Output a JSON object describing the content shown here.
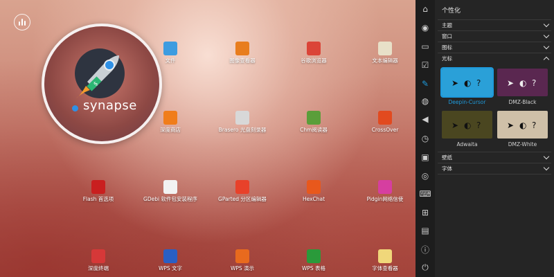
{
  "desktop": {
    "synapse_label": "synapse",
    "apps": [
      {
        "label": "文件",
        "icon": "folder-icon",
        "color": "#3d9ce0"
      },
      {
        "label": "图像查看器",
        "icon": "image-viewer-icon",
        "color": "#e87d1e"
      },
      {
        "label": "谷歌浏览器",
        "icon": "chrome-icon",
        "color": "#db4437"
      },
      {
        "label": "文本编辑器",
        "icon": "text-editor-icon",
        "color": "#e8e0c8"
      },
      {
        "label": "深度商店",
        "icon": "store-icon",
        "color": "#f07d1b"
      },
      {
        "label": "Brasero 光盘刻录器",
        "icon": "disc-burner-icon",
        "color": "#d8d8d8"
      },
      {
        "label": "Chm阅读器",
        "icon": "chm-reader-icon",
        "color": "#5a9e3a"
      },
      {
        "label": "CrossOver",
        "icon": "crossover-icon",
        "color": "#e24a1f"
      },
      {
        "label": "Flash 首选项",
        "icon": "flash-icon",
        "color": "#c91f1f"
      },
      {
        "label": "GDebi 软件包安装程序",
        "icon": "debian-package-icon",
        "color": "#f2f2f2"
      },
      {
        "label": "GParted 分区编辑器",
        "icon": "partition-editor-icon",
        "color": "#e8412a"
      },
      {
        "label": "HexChat",
        "icon": "hexchat-icon",
        "color": "#e8581c"
      },
      {
        "label": "Pidgin网络信使",
        "icon": "pidgin-icon",
        "color": "#d63ea0"
      },
      {
        "label": "深度终端",
        "icon": "terminal-icon",
        "color": "#d63838"
      },
      {
        "label": "WPS 文字",
        "icon": "wps-writer-icon",
        "color": "#2a5fc4"
      },
      {
        "label": "WPS 演示",
        "icon": "wps-presentation-icon",
        "color": "#e86a1e"
      },
      {
        "label": "WPS 表格",
        "icon": "wps-spreadsheet-icon",
        "color": "#2a9a3a"
      },
      {
        "label": "字体查看器",
        "icon": "font-viewer-icon",
        "color": "#f0d77a"
      }
    ]
  },
  "panel": {
    "title": "个性化",
    "sections": {
      "theme": "主题",
      "window": "窗口",
      "icons": "图标",
      "cursor": "光标",
      "wallpaper": "壁纸",
      "font": "字体"
    },
    "cursors": [
      {
        "name": "Deepin-Cursor",
        "bg": "#2aa0d8",
        "selected": true
      },
      {
        "name": "DMZ-Black",
        "bg": "#5a2750",
        "selected": false
      },
      {
        "name": "Adwaita",
        "bg": "#4a4620",
        "selected": false
      },
      {
        "name": "DMZ-White",
        "bg": "#cfc0a8",
        "selected": false
      }
    ],
    "accent": "#1e9bdd"
  },
  "sidebar": {
    "icons": [
      "home-icon",
      "account-icon",
      "display-icon",
      "default-apps-icon",
      "personalization-icon",
      "network-icon",
      "sound-icon",
      "datetime-icon",
      "power-icon",
      "mouse-icon",
      "keyboard-icon",
      "shortcuts-icon",
      "system-info-icon",
      "info-icon",
      "shutdown-icon"
    ]
  }
}
